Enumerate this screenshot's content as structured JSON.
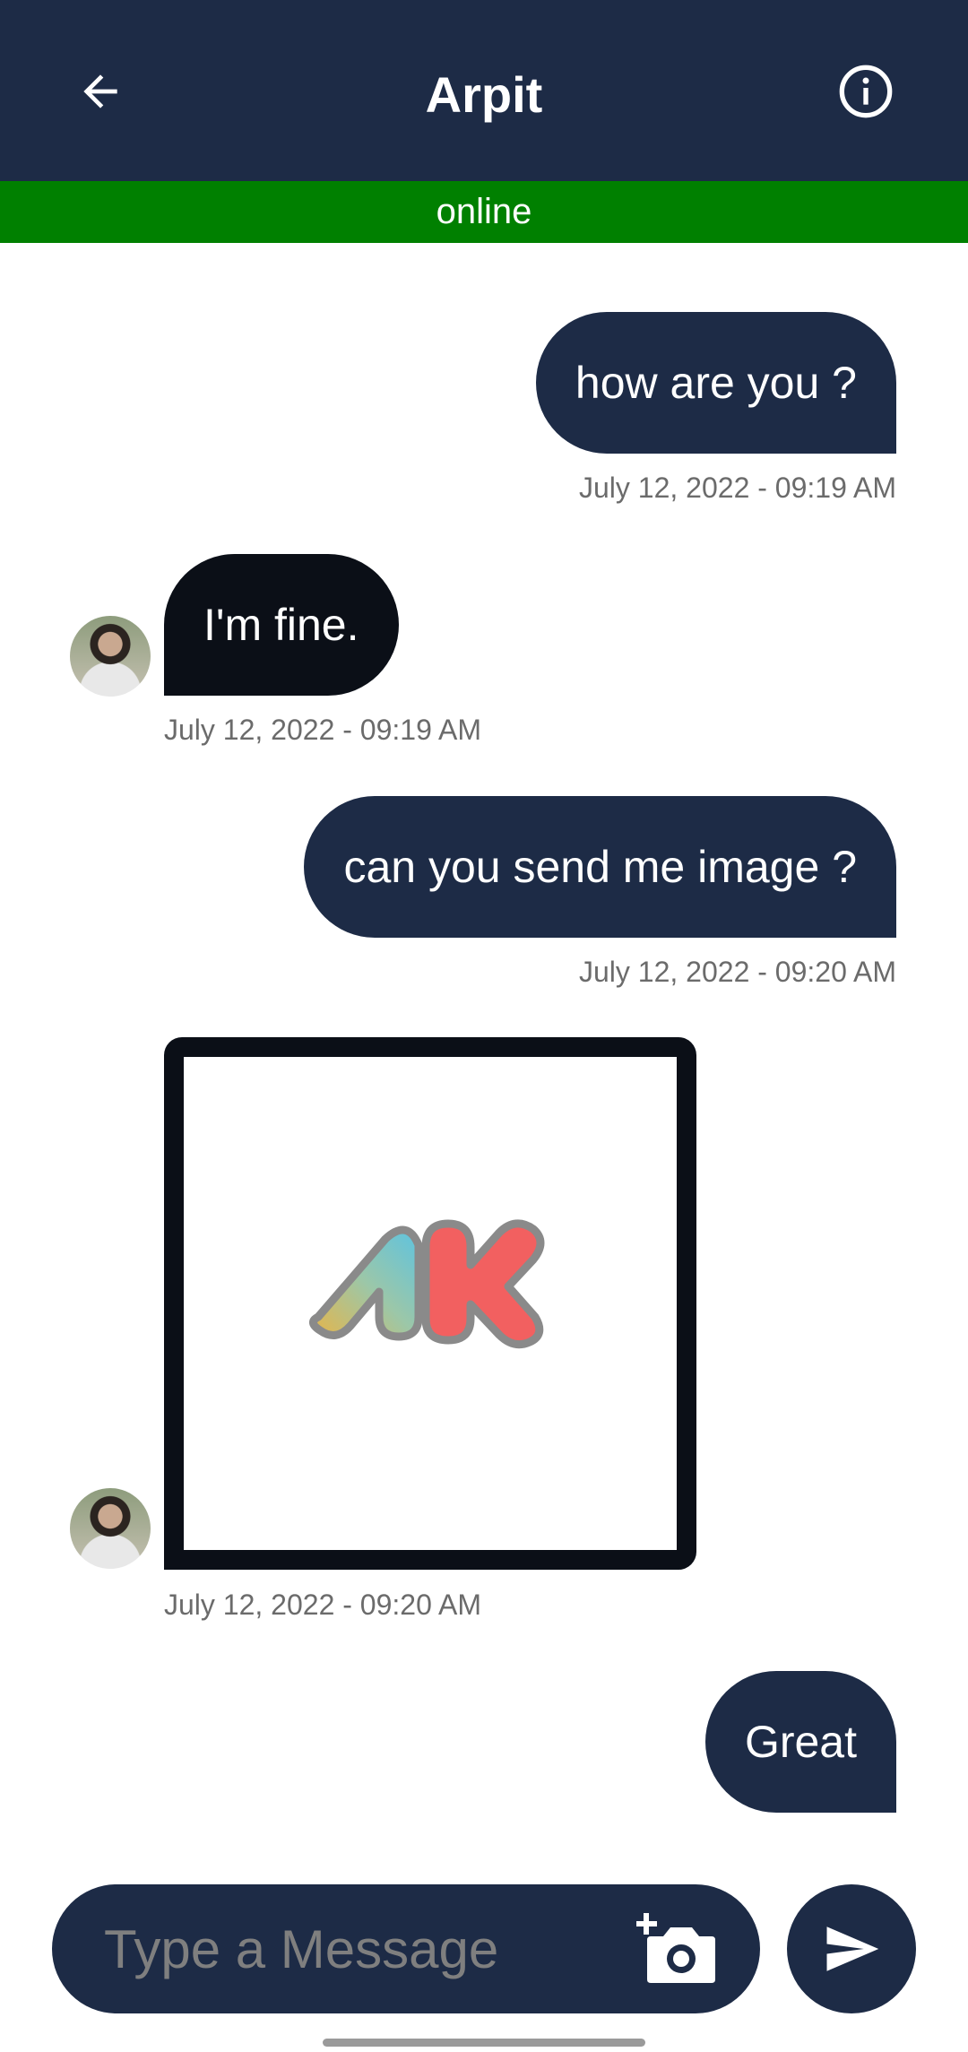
{
  "header": {
    "title": "Arpit",
    "back_icon": "arrow-left-icon",
    "info_icon": "info-circle-icon",
    "status": "online"
  },
  "colors": {
    "appbar": "#1d2b46",
    "status_bar": "#008000",
    "incoming_bubble": "#0b0f17",
    "outgoing_bubble": "#1d2b46",
    "timestamp": "#6b6b6b"
  },
  "messages": [
    {
      "direction": "outgoing",
      "type": "text",
      "text": "how are you ?",
      "time": "July 12, 2022 - 09:19 AM"
    },
    {
      "direction": "incoming",
      "type": "text",
      "text": "I'm fine.",
      "time": "July 12, 2022 - 09:19 AM"
    },
    {
      "direction": "outgoing",
      "type": "text",
      "text": "can you send me image ?",
      "time": "July 12, 2022 - 09:20 AM"
    },
    {
      "direction": "incoming",
      "type": "image",
      "image": "AK logo",
      "time": "July 12, 2022 - 09:20 AM"
    },
    {
      "direction": "outgoing",
      "type": "text",
      "text": "Great",
      "time": ""
    }
  ],
  "composer": {
    "placeholder": "Type a Message",
    "value": "",
    "camera_icon": "add-photo-camera-icon",
    "send_icon": "send-icon"
  }
}
